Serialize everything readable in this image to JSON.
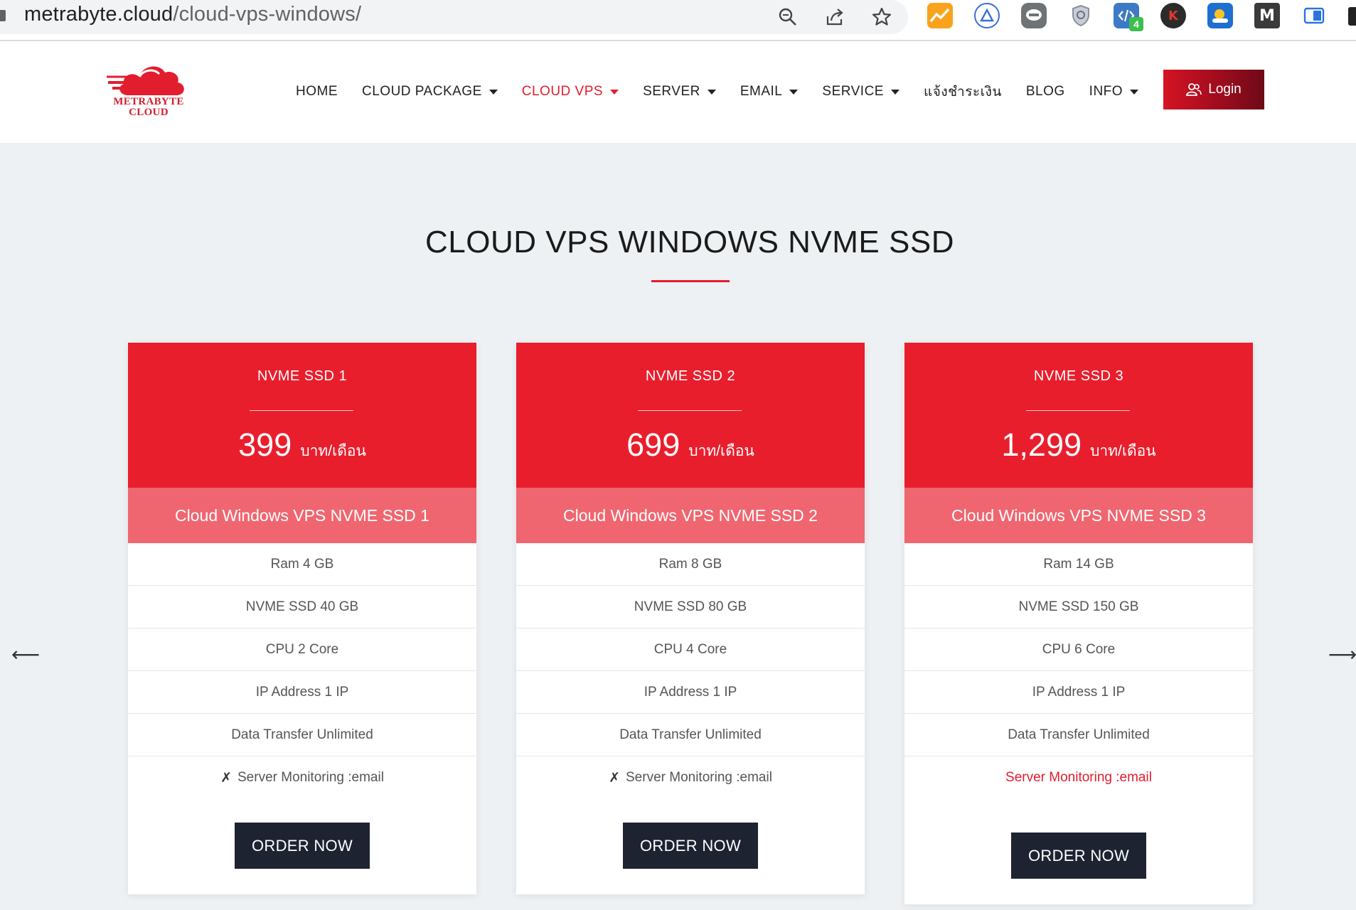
{
  "browser": {
    "url_host": "metrabyte.cloud",
    "url_path": "/cloud-vps-windows/",
    "extension_badge": "4",
    "extension_letters": [
      "K",
      "M"
    ]
  },
  "header": {
    "logo_line1": "METRABYTE",
    "logo_line2": "CLOUD",
    "nav": [
      {
        "label": "HOME",
        "dropdown": false,
        "active": false
      },
      {
        "label": "CLOUD PACKAGE",
        "dropdown": true,
        "active": false
      },
      {
        "label": "CLOUD VPS",
        "dropdown": true,
        "active": true
      },
      {
        "label": "SERVER",
        "dropdown": true,
        "active": false
      },
      {
        "label": "EMAIL",
        "dropdown": true,
        "active": false
      },
      {
        "label": "SERVICE",
        "dropdown": true,
        "active": false
      },
      {
        "label": "แจ้งชำระเงิน",
        "dropdown": false,
        "active": false
      },
      {
        "label": "BLOG",
        "dropdown": false,
        "active": false
      },
      {
        "label": "INFO",
        "dropdown": true,
        "active": false
      }
    ],
    "login_label": "Login"
  },
  "section": {
    "title": "CLOUD VPS WINDOWS NVME SSD",
    "prev_arrow": "⟵",
    "next_arrow": "⟶"
  },
  "colors": {
    "accent": "#e21d2e",
    "card_header": "#e91e2d",
    "card_sub": "#ef6670",
    "order_button": "#1d2331"
  },
  "plans": [
    {
      "name": "NVME SSD 1",
      "price": "399",
      "unit": "บาท/เดือน",
      "subtitle": "Cloud Windows VPS NVME SSD 1",
      "features": [
        "Ram 4 GB",
        "NVME SSD 40 GB",
        "CPU 2 Core",
        "IP Address 1 IP",
        "Data Transfer Unlimited"
      ],
      "monitoring": {
        "mark": "✗",
        "text": "Server Monitoring :email",
        "included": false
      },
      "order_label": "ORDER NOW"
    },
    {
      "name": "NVME SSD 2",
      "price": "699",
      "unit": "บาท/เดือน",
      "subtitle": "Cloud Windows VPS NVME SSD 2",
      "features": [
        "Ram 8 GB",
        "NVME SSD 80 GB",
        "CPU 4 Core",
        "IP Address 1 IP",
        "Data Transfer Unlimited"
      ],
      "monitoring": {
        "mark": "✗",
        "text": "Server Monitoring :email",
        "included": false
      },
      "order_label": "ORDER NOW"
    },
    {
      "name": "NVME SSD 3",
      "price": "1,299",
      "unit": "บาท/เดือน",
      "subtitle": "Cloud Windows VPS NVME SSD 3",
      "features": [
        "Ram 14 GB",
        "NVME SSD 150 GB",
        "CPU 6 Core",
        "IP Address 1 IP",
        "Data Transfer Unlimited"
      ],
      "monitoring": {
        "mark": "",
        "text": "Server Monitoring :email",
        "included": true
      },
      "order_label": "ORDER NOW"
    }
  ]
}
